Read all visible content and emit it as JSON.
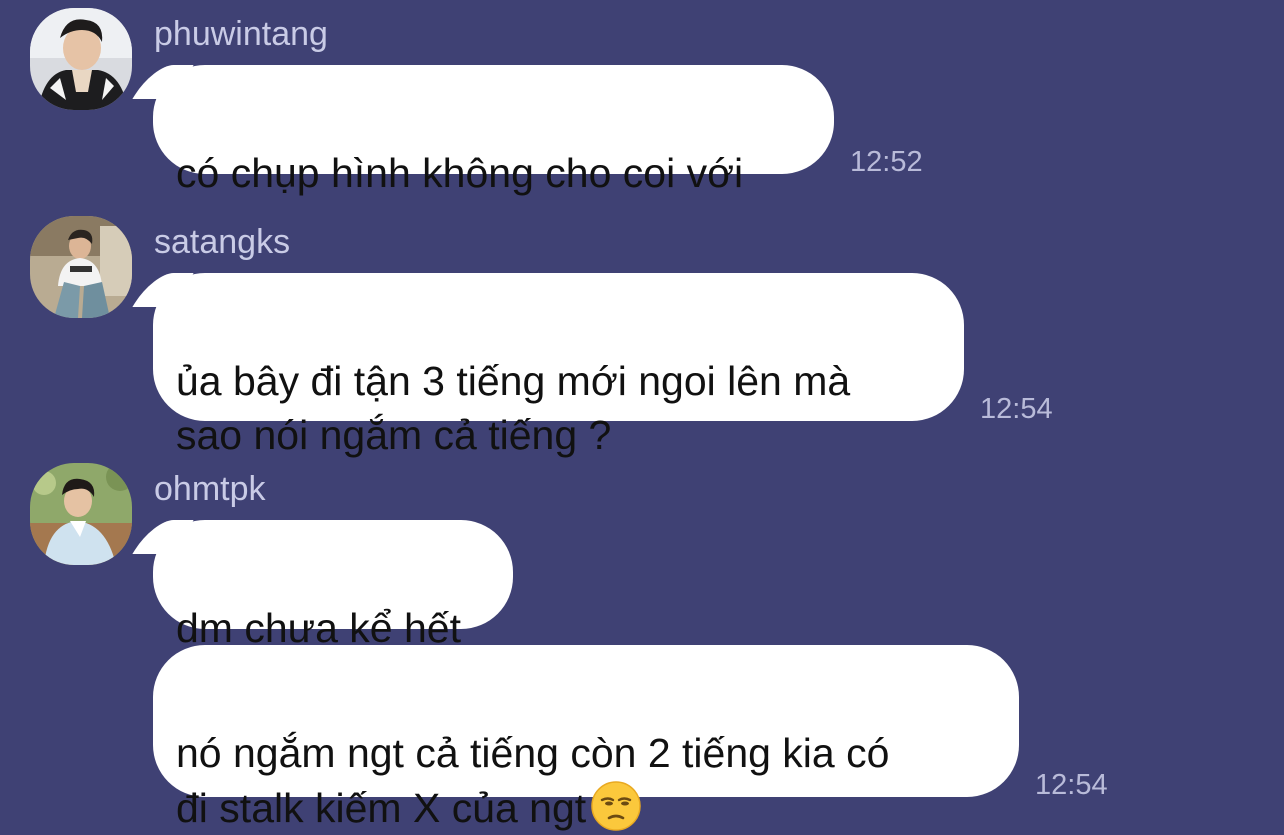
{
  "colors": {
    "background": "#3f4174",
    "bubble": "#ffffff",
    "username": "#c9cbe6",
    "timestamp": "#b9bbd9"
  },
  "messages": [
    {
      "username": "phuwintang",
      "avatar_icon": "user-avatar-phuwintang",
      "bubbles": [
        {
          "text": "có chụp hình không cho coi với"
        }
      ],
      "time": "12:52"
    },
    {
      "username": "satangks",
      "avatar_icon": "user-avatar-satangks",
      "bubbles": [
        {
          "text": "ủa bây đi tận 3 tiếng mới ngoi lên mà\nsao nói ngắm cả tiếng ?"
        }
      ],
      "time": "12:54"
    },
    {
      "username": "ohmtpk",
      "avatar_icon": "user-avatar-ohmtpk",
      "bubbles": [
        {
          "text": "dm chưa kể hết"
        },
        {
          "text": "nó ngắm ngt cả tiếng còn 2 tiếng kia có\nđi stalk kiếm X của ngt",
          "emoji": "unamused-face-icon"
        }
      ],
      "time": "12:54"
    }
  ]
}
